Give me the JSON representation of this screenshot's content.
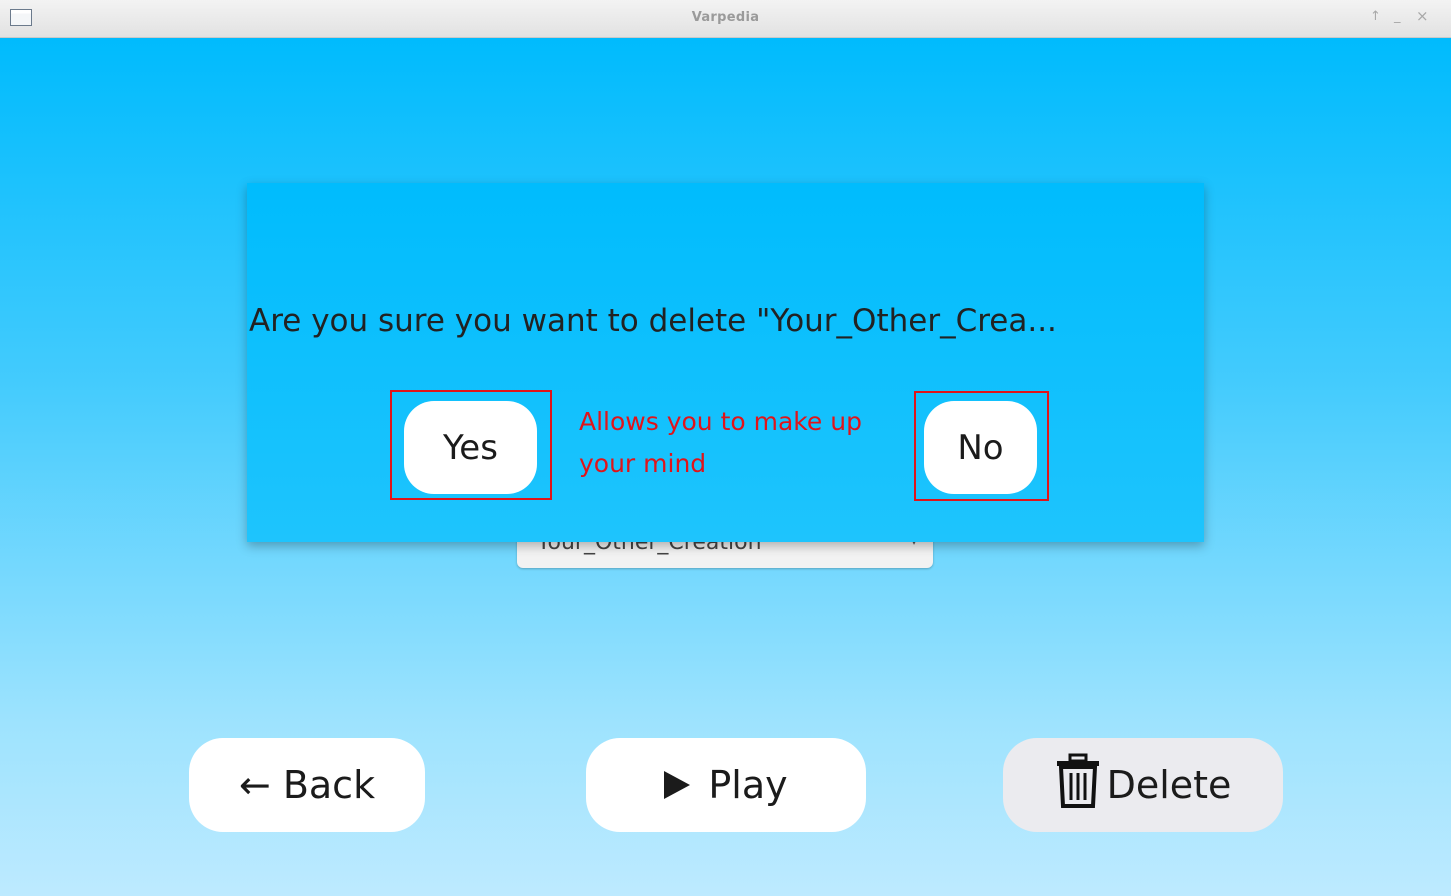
{
  "window": {
    "title": "Varpedia",
    "controls": {
      "up": "↑",
      "minimize": "_",
      "close": "×"
    }
  },
  "creation_select": {
    "selected": "Your_Other_Creation",
    "arrow": "▾"
  },
  "buttons": {
    "back": "← Back",
    "play": "Play",
    "delete": "Delete"
  },
  "dialog": {
    "message": "Are you sure you want to delete \"Your_Other_Crea...",
    "yes_label": "Yes",
    "no_label": "No"
  },
  "annotation": {
    "text": "Allows you to make up your mind",
    "color": "#e0141a"
  },
  "colors": {
    "background_top": "#00bbfd",
    "background_bottom": "#bdeaff",
    "button_bg": "#ffffff",
    "delete_button_bg": "#ebebef"
  },
  "icons": {
    "window_icon": "window-icon",
    "play": "play-icon",
    "delete": "trash-icon"
  }
}
